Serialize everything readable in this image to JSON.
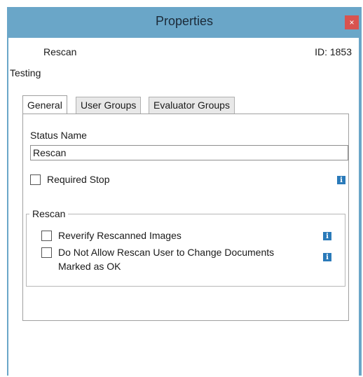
{
  "window": {
    "title": "Properties",
    "close_label": "×"
  },
  "header": {
    "name": "Rescan",
    "id": "ID: 1853"
  },
  "subtitle": "Testing",
  "tabs": [
    {
      "label": "General",
      "active": true
    },
    {
      "label": "User Groups",
      "active": false
    },
    {
      "label": "Evaluator Groups",
      "active": false
    }
  ],
  "general": {
    "status_name_label": "Status Name",
    "status_name_value": "Rescan",
    "required_stop_label": "Required Stop",
    "required_stop_checked": false,
    "rescan_group": {
      "title": "Rescan",
      "reverify_label": "Reverify Rescanned Images",
      "reverify_checked": false,
      "no_change_label_line1": "Do Not Allow Rescan User to Change Documents",
      "no_change_label_line2": "Marked as OK",
      "no_change_checked": false
    }
  },
  "info_icon_glyph": "i",
  "colors": {
    "title_bar": "#6aa6c8",
    "close_button": "#d9534f",
    "info_icon": "#2a7ab9"
  }
}
